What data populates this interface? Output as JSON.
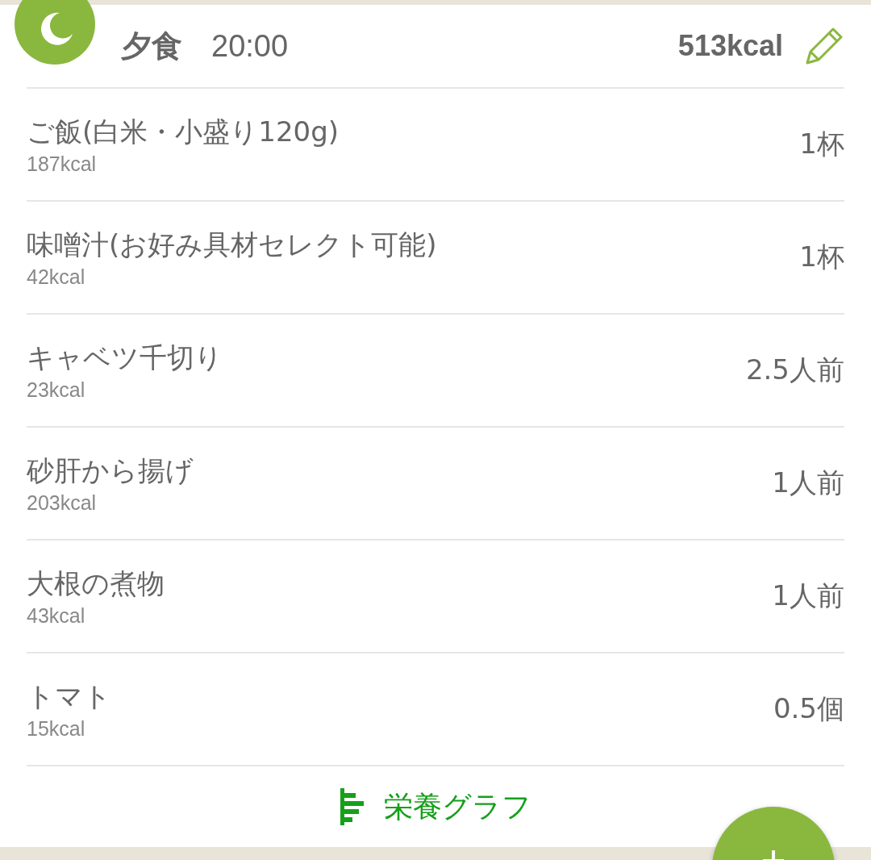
{
  "meal": {
    "name": "夕食",
    "time": "20:00",
    "total": "513kcal"
  },
  "items": [
    {
      "name": "ご飯(白米・小盛り120g)",
      "kcal": "187kcal",
      "amount": "1杯"
    },
    {
      "name": "味噌汁(お好み具材セレクト可能)",
      "kcal": "42kcal",
      "amount": "1杯"
    },
    {
      "name": "キャベツ千切り",
      "kcal": "23kcal",
      "amount": "2.5人前"
    },
    {
      "name": "砂肝から揚げ",
      "kcal": "203kcal",
      "amount": "1人前"
    },
    {
      "name": "大根の煮物",
      "kcal": "43kcal",
      "amount": "1人前"
    },
    {
      "name": "トマト",
      "kcal": "15kcal",
      "amount": "0.5個"
    }
  ],
  "footer": {
    "link": "栄養グラフ"
  }
}
